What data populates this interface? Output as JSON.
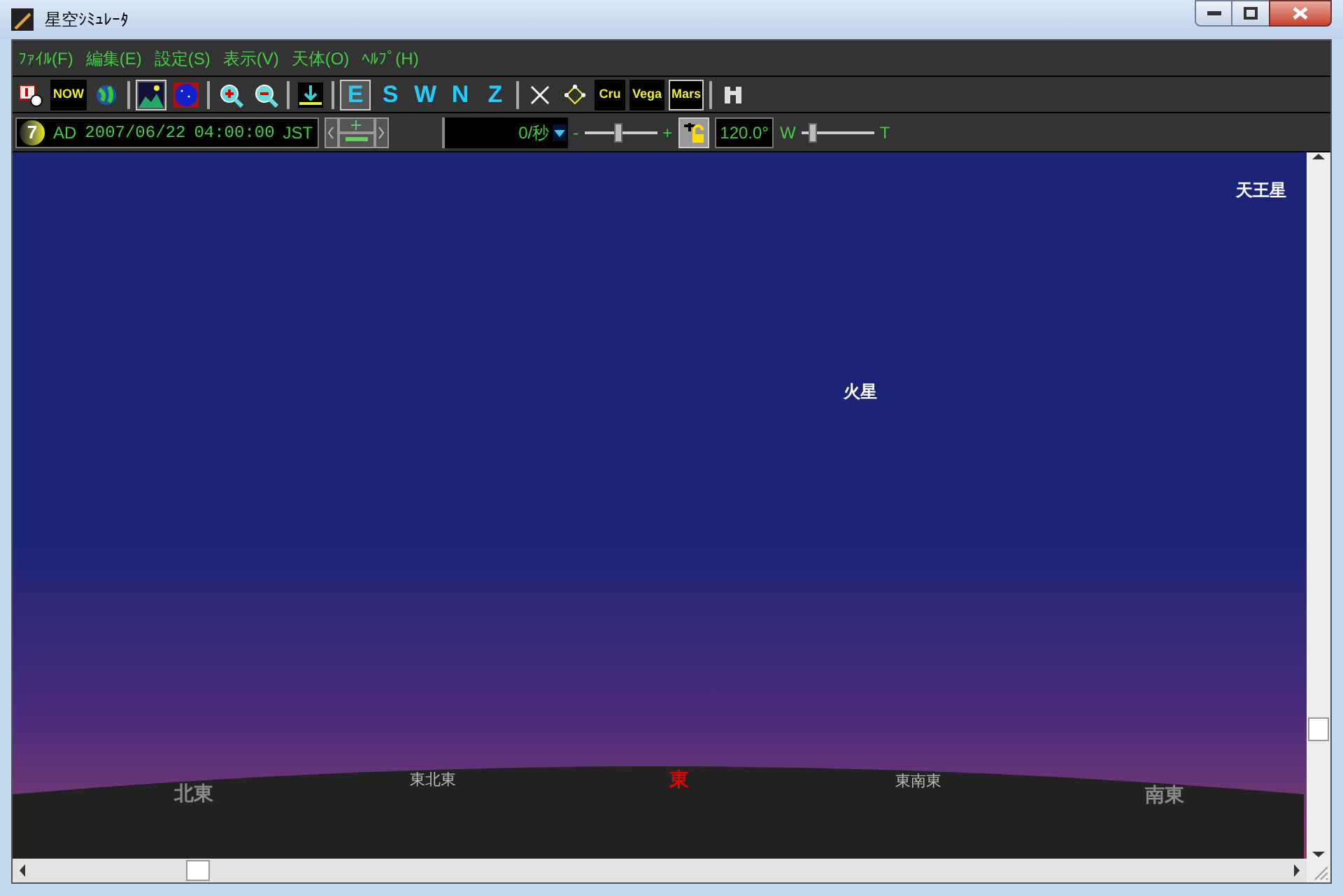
{
  "window": {
    "title": "星空ｼﾐｭﾚｰﾀ"
  },
  "menu": [
    "ﾌｧｲﾙ(F)",
    "編集(E)",
    "設定(S)",
    "表示(V)",
    "天体(O)",
    "ﾍﾙﾌﾟ(H)"
  ],
  "toolbar": [
    {
      "kind": "icon",
      "selected": false
    },
    {
      "kind": "label",
      "text": "NOW",
      "selected": false
    },
    {
      "kind": "icon",
      "selected": false
    },
    {
      "kind": "sep"
    },
    {
      "kind": "icon",
      "selected": true
    },
    {
      "kind": "icon",
      "selected": false
    },
    {
      "kind": "sep"
    },
    {
      "kind": "icon",
      "selected": false
    },
    {
      "kind": "icon",
      "selected": false
    },
    {
      "kind": "sep"
    },
    {
      "kind": "icon",
      "selected": false
    },
    {
      "kind": "sep"
    },
    {
      "kind": "letter",
      "text": "E",
      "selected": true
    },
    {
      "kind": "letter",
      "text": "S",
      "selected": false
    },
    {
      "kind": "letter",
      "text": "W",
      "selected": false
    },
    {
      "kind": "letter",
      "text": "N",
      "selected": false
    },
    {
      "kind": "letter",
      "text": "Z",
      "selected": false
    },
    {
      "kind": "sep"
    },
    {
      "kind": "icon",
      "selected": false
    },
    {
      "kind": "icon",
      "selected": false
    },
    {
      "kind": "label",
      "text": "Cru",
      "selected": false
    },
    {
      "kind": "label",
      "text": "Vega",
      "selected": false
    },
    {
      "kind": "label",
      "text": "Mars",
      "selected": true
    },
    {
      "kind": "sep"
    },
    {
      "kind": "icon",
      "selected": false
    }
  ],
  "time": {
    "badge": "7",
    "era": "AD",
    "date": "2007/06/22",
    "time": "04:00:00",
    "zone": "JST"
  },
  "speed": {
    "value": "0/秒",
    "minus": "-",
    "plus": "+",
    "level": 0.46
  },
  "fov": {
    "value": "120.0°",
    "wide": "W",
    "tele": "T",
    "level": 0.12
  },
  "sky": {
    "labels": [
      {
        "text": "天王星"
      },
      {
        "text": "火星"
      }
    ]
  },
  "horizon": [
    {
      "text": "北東",
      "kind": "major",
      "selected": false
    },
    {
      "text": "東北東",
      "kind": "minor",
      "selected": false
    },
    {
      "text": "東",
      "kind": "major",
      "selected": true
    },
    {
      "text": "東南東",
      "kind": "minor",
      "selected": false
    },
    {
      "text": "南東",
      "kind": "major",
      "selected": false
    }
  ]
}
